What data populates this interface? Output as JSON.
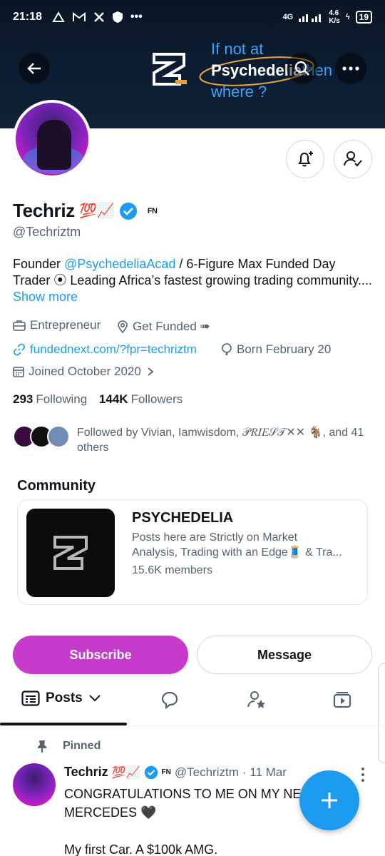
{
  "status_bar": {
    "time": "21:18",
    "icons": [
      "triangle-icon",
      "gmail-icon",
      "x-icon",
      "shield-icon"
    ],
    "dots": "•••",
    "network": "4G",
    "speed": "4.6",
    "speed_unit": "K/s",
    "battery": "19"
  },
  "banner": {
    "tagline_line1": "If not at",
    "tagline_brand": "Psychedelia",
    "tagline_then": "then",
    "tagline_line3": "where ?",
    "bg_color": "#0c1e33",
    "accent_color": "#3aa4ff"
  },
  "profile": {
    "name": "Techriz",
    "name_emoji": "💯📈",
    "fn_badge": "FN",
    "handle": "@Techriztm",
    "bio_prefix": "Founder ",
    "bio_mention": "@PsychedeliaAcad",
    "bio_rest": " / 6-Figure Max Funded Day Trader ⦿ Leading Africa’s fastest growing trading community.... ",
    "bio_show_more": "Show more",
    "category": "Entrepreneur",
    "location": "Get Funded ➠",
    "website": "fundednext.com/?fpr=techriztm",
    "birthday": "Born February 20",
    "joined": "Joined October 2020",
    "following_count": "293",
    "following_label": "Following",
    "followers_count": "144K",
    "followers_label": "Followers",
    "followed_by": "Followed by Vivian, Iamwisdom, 𝒫𝑅𝐼𝐸𝒮𝒯✕✕ 🐐, and 41 others"
  },
  "community": {
    "section_title": "Community",
    "name": "PSYCHEDELIA",
    "description_line1": "Posts here are Strictly on Market",
    "description_line2": "Analysis, Trading with an Edge🧵 & Tra...",
    "members": "15.6K members"
  },
  "actions": {
    "subscribe": "Subscribe",
    "message": "Message",
    "subscribe_color": "#c63bcc"
  },
  "tabs": {
    "posts": "Posts",
    "other_icons": [
      "reply-icon",
      "highlights-icon",
      "media-icon"
    ]
  },
  "pinned_tweet": {
    "pinned_label": "Pinned",
    "name": "Techriz",
    "name_emoji": "💯📈",
    "fn_badge": "FN",
    "handle": "@Techriztm",
    "date": "· 11 Mar",
    "text_line1": "CONGRATULATIONS TO ME ON MY NE",
    "text_line2": "MERCEDES 🖤",
    "text_line3": "My first Car. A $100k AMG."
  },
  "colors": {
    "link": "#1d9bf0",
    "verified": "#1d9bf0",
    "text": "#0f1419",
    "secondary": "#536471"
  }
}
